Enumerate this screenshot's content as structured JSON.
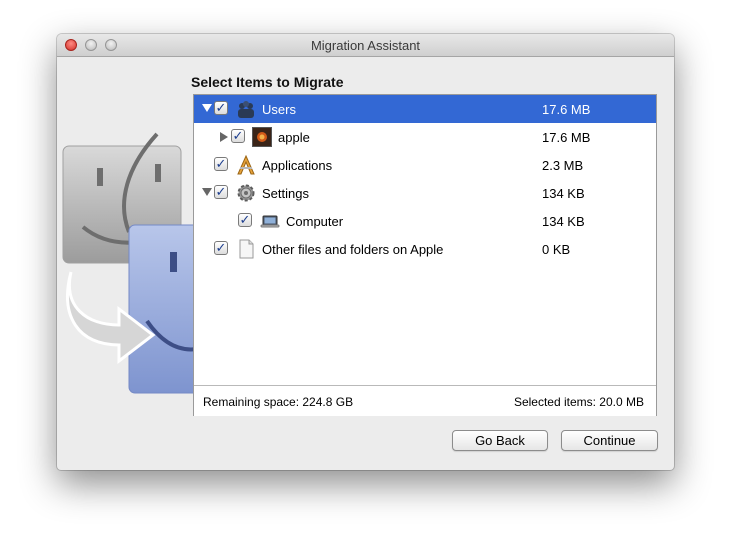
{
  "window": {
    "title": "Migration Assistant"
  },
  "heading": "Select Items to Migrate",
  "items": [
    {
      "name": "Users",
      "size": "17.6 MB",
      "checked": true,
      "expanded": true,
      "icon": "users-group-icon",
      "selected": true
    },
    {
      "name": "apple",
      "size": "17.6 MB",
      "checked": true,
      "expanded": false,
      "icon": "user-picture-icon"
    },
    {
      "name": "Applications",
      "size": "2.3 MB",
      "checked": true,
      "icon": "applications-folder-icon"
    },
    {
      "name": "Settings",
      "size": "134 KB",
      "checked": true,
      "expanded": true,
      "icon": "gear-icon"
    },
    {
      "name": "Computer",
      "size": "134 KB",
      "checked": true,
      "icon": "laptop-icon"
    },
    {
      "name": "Other files and folders on Apple",
      "size": "0 KB",
      "checked": true,
      "icon": "document-icon"
    }
  ],
  "footer": {
    "remaining": "Remaining space: 224.8 GB",
    "selected": "Selected items: 20.0 MB"
  },
  "buttons": {
    "back": "Go Back",
    "continue": "Continue"
  },
  "colors": {
    "selection": "#3368d4",
    "checkmark": "#1d3e8e"
  }
}
